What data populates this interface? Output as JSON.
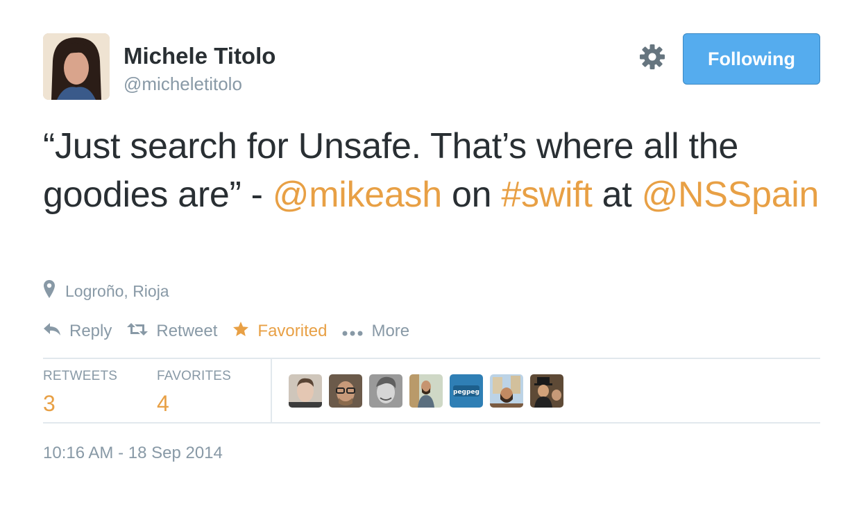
{
  "user": {
    "name": "Michele Titolo",
    "handle": "@micheletitolo"
  },
  "follow_button": {
    "label": "Following"
  },
  "tweet": {
    "text_a": "“Just search for Unsafe. That’s where all the goodies are” - ",
    "mention_1": "@mikeash",
    "text_b": " on ",
    "hashtag": "#swift",
    "text_c": " at ",
    "mention_2": "@NSSpain"
  },
  "location": {
    "text": "Logroño, Rioja",
    "icon": "map-pin-icon"
  },
  "actions": {
    "reply": "Reply",
    "retweet": "Retweet",
    "favorite": "Favorited",
    "more": "More"
  },
  "stats": {
    "retweets_label": "RETWEETS",
    "retweets_count": "3",
    "favorites_label": "FAVORITES",
    "favorites_count": "4"
  },
  "favoriters": [
    {
      "label": ""
    },
    {
      "label": ""
    },
    {
      "label": ""
    },
    {
      "label": ""
    },
    {
      "label": "pegpeg"
    },
    {
      "label": ""
    },
    {
      "label": ""
    }
  ],
  "timestamp": "10:16 AM - 18 Sep 2014",
  "colors": {
    "accent": "#e8a045",
    "button_blue": "#55acee",
    "muted": "#8899a6",
    "text": "#292f33"
  }
}
